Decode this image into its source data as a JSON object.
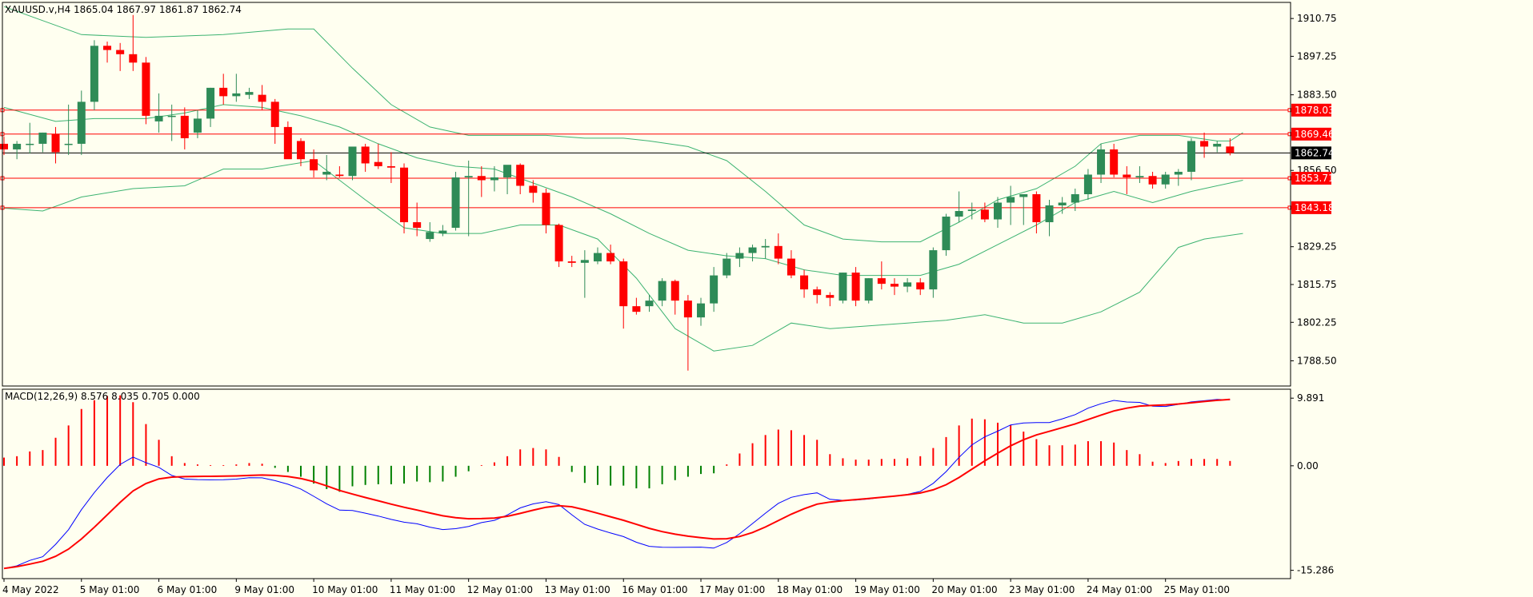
{
  "header": {
    "symbol": "XAUUSD.v,H4",
    "ohlc": "1865.04 1867.97 1861.87 1862.74"
  },
  "macd_header": "MACD(12,26,9) 8.576 8.035 0.705 0.000",
  "colors": {
    "background": "#fffff0",
    "bull": "#2e8b57",
    "bear": "#ff0000",
    "bands": "#3cb371",
    "level_line": "#ff0000",
    "macd_line": "#0000ff",
    "signal_line": "#ff0000",
    "hist_pos": "#ff0000",
    "hist_neg": "#008000"
  },
  "chart_data": [
    {
      "type": "candlestick",
      "title": "XAUUSD.v,H4",
      "price_range": [
        1779.5,
        1916.5
      ],
      "y_ticks": [
        "1910.75",
        "1897.25",
        "1883.50",
        "1856.50",
        "1829.25",
        "1815.75",
        "1802.25",
        "1788.50"
      ],
      "x_ticks": [
        "4 May 2022",
        "5 May 01:00",
        "6 May 01:00",
        "9 May 01:00",
        "10 May 01:00",
        "11 May 01:00",
        "12 May 01:00",
        "13 May 01:00",
        "16 May 01:00",
        "17 May 01:00",
        "18 May 01:00",
        "19 May 01:00",
        "20 May 01:00",
        "23 May 01:00",
        "24 May 01:00",
        "25 May 01:00"
      ],
      "current_price": "1862.74",
      "levels": [
        "1878.03",
        "1869.46",
        "1853.71",
        "1843.18"
      ],
      "candles": [
        [
          1866.0,
          1868.5,
          1862.0,
          1864.0
        ],
        [
          1864.0,
          1867.0,
          1860.5,
          1866.0
        ],
        [
          1866.0,
          1873.5,
          1862.5,
          1866.0
        ],
        [
          1866.0,
          1870.0,
          1863.0,
          1870.0
        ],
        [
          1869.5,
          1872.0,
          1859.0,
          1863.0
        ],
        [
          1866.0,
          1880.0,
          1862.0,
          1866.0
        ],
        [
          1866.0,
          1885.0,
          1862.0,
          1881.0
        ],
        [
          1881.0,
          1903.0,
          1878.0,
          1901.0
        ],
        [
          1901.0,
          1902.5,
          1895.0,
          1899.5
        ],
        [
          1899.5,
          1902.0,
          1892.0,
          1898.0
        ],
        [
          1898.0,
          1912.0,
          1892.0,
          1895.0
        ],
        [
          1895.0,
          1897.0,
          1873.0,
          1876.0
        ],
        [
          1874.0,
          1884.0,
          1870.0,
          1876.0
        ],
        [
          1876.0,
          1880.0,
          1867.0,
          1876.0
        ],
        [
          1876.0,
          1879.0,
          1864.0,
          1868.0
        ],
        [
          1870.0,
          1878.0,
          1868.0,
          1875.0
        ],
        [
          1875.0,
          1886.0,
          1872.0,
          1886.0
        ],
        [
          1886.0,
          1891.0,
          1880.0,
          1883.0
        ],
        [
          1883.0,
          1891.0,
          1881.0,
          1884.0
        ],
        [
          1883.5,
          1886.0,
          1882.0,
          1884.5
        ],
        [
          1883.5,
          1887.0,
          1878.0,
          1881.0
        ],
        [
          1881.0,
          1882.0,
          1866.0,
          1872.0
        ],
        [
          1872.0,
          1874.0,
          1863.0,
          1860.5
        ],
        [
          1867.0,
          1868.0,
          1858.0,
          1860.5
        ],
        [
          1860.5,
          1864.0,
          1854.0,
          1856.5
        ],
        [
          1855.0,
          1862.0,
          1853.0,
          1856.0
        ],
        [
          1855.0,
          1858.0,
          1854.0,
          1854.5
        ],
        [
          1854.5,
          1864.0,
          1853.0,
          1865.0
        ],
        [
          1865.0,
          1866.0,
          1856.0,
          1859.0
        ],
        [
          1859.5,
          1866.0,
          1857.0,
          1858.0
        ],
        [
          1858.0,
          1863.0,
          1852.0,
          1857.5
        ],
        [
          1857.5,
          1859.0,
          1834.0,
          1838.0
        ],
        [
          1838.0,
          1845.0,
          1833.0,
          1836.0
        ],
        [
          1832.0,
          1838.0,
          1831.0,
          1834.5
        ],
        [
          1834.0,
          1837.0,
          1833.0,
          1835.0
        ],
        [
          1836.0,
          1856.0,
          1835.0,
          1854.0
        ],
        [
          1854.0,
          1860.0,
          1833.0,
          1854.5
        ],
        [
          1854.5,
          1858.0,
          1847.0,
          1853.0
        ],
        [
          1853.0,
          1858.0,
          1849.0,
          1854.0
        ],
        [
          1854.0,
          1858.0,
          1848.0,
          1858.5
        ],
        [
          1858.5,
          1859.0,
          1848.0,
          1851.0
        ],
        [
          1851.0,
          1853.0,
          1845.0,
          1848.5
        ],
        [
          1848.5,
          1850.0,
          1834.0,
          1837.0
        ],
        [
          1837.0,
          1837.5,
          1822.0,
          1824.0
        ],
        [
          1824.0,
          1826.0,
          1822.0,
          1823.5
        ],
        [
          1823.5,
          1828.0,
          1811.0,
          1824.5
        ],
        [
          1824.0,
          1829.0,
          1823.0,
          1827.0
        ],
        [
          1827.0,
          1830.0,
          1823.0,
          1824.0
        ],
        [
          1824.0,
          1825.0,
          1800.0,
          1808.0
        ],
        [
          1808.0,
          1811.0,
          1805.0,
          1806.0
        ],
        [
          1808.0,
          1812.0,
          1806.0,
          1810.0
        ],
        [
          1810.0,
          1818.0,
          1808.0,
          1817.0
        ],
        [
          1817.0,
          1817.5,
          1805.0,
          1810.0
        ],
        [
          1810.0,
          1812.0,
          1785.0,
          1804.0
        ],
        [
          1804.0,
          1811.0,
          1801.0,
          1809.0
        ],
        [
          1809.0,
          1822.0,
          1806.0,
          1819.0
        ],
        [
          1819.0,
          1827.0,
          1818.0,
          1825.0
        ],
        [
          1825.0,
          1829.0,
          1822.0,
          1827.0
        ],
        [
          1827.0,
          1830.0,
          1824.0,
          1829.0
        ],
        [
          1829.0,
          1832.0,
          1825.0,
          1829.5
        ],
        [
          1829.5,
          1834.0,
          1823.0,
          1825.0
        ],
        [
          1825.0,
          1828.0,
          1818.0,
          1819.0
        ],
        [
          1819.0,
          1821.0,
          1811.0,
          1814.0
        ],
        [
          1814.0,
          1815.0,
          1809.0,
          1812.0
        ],
        [
          1812.0,
          1813.0,
          1808.0,
          1811.0
        ],
        [
          1810.0,
          1820.0,
          1809.0,
          1820.0
        ],
        [
          1820.0,
          1822.0,
          1808.0,
          1810.0
        ],
        [
          1810.0,
          1818.0,
          1809.0,
          1818.0
        ],
        [
          1818.0,
          1824.0,
          1814.0,
          1816.0
        ],
        [
          1816.0,
          1818.0,
          1812.0,
          1815.0
        ],
        [
          1815.0,
          1818.0,
          1813.0,
          1816.5
        ],
        [
          1816.5,
          1818.0,
          1812.0,
          1814.0
        ],
        [
          1814.0,
          1829.0,
          1811.0,
          1828.0
        ],
        [
          1828.0,
          1841.0,
          1826.0,
          1840.0
        ],
        [
          1840.0,
          1849.0,
          1838.0,
          1842.0
        ],
        [
          1842.0,
          1845.0,
          1839.0,
          1842.5
        ],
        [
          1842.5,
          1845.0,
          1838.0,
          1839.0
        ],
        [
          1839.0,
          1847.0,
          1836.0,
          1845.0
        ],
        [
          1845.0,
          1851.0,
          1837.0,
          1847.0
        ],
        [
          1847.0,
          1848.0,
          1837.0,
          1848.0
        ],
        [
          1848.0,
          1849.0,
          1834.0,
          1838.0
        ],
        [
          1838.0,
          1846.0,
          1833.0,
          1844.0
        ],
        [
          1844.0,
          1847.0,
          1841.0,
          1845.0
        ],
        [
          1845.0,
          1850.0,
          1842.0,
          1848.0
        ],
        [
          1848.0,
          1857.0,
          1846.0,
          1855.0
        ],
        [
          1855.0,
          1866.0,
          1852.0,
          1864.0
        ],
        [
          1864.0,
          1866.0,
          1854.0,
          1855.0
        ],
        [
          1855.0,
          1858.0,
          1848.0,
          1854.0
        ],
        [
          1854.0,
          1858.0,
          1852.0,
          1854.5
        ],
        [
          1854.5,
          1856.0,
          1850.0,
          1851.5
        ],
        [
          1851.5,
          1856.0,
          1850.0,
          1855.0
        ],
        [
          1855.0,
          1857.0,
          1851.0,
          1856.0
        ],
        [
          1856.0,
          1868.0,
          1853.0,
          1867.0
        ],
        [
          1867.0,
          1870.0,
          1861.0,
          1865.0
        ],
        [
          1865.0,
          1867.0,
          1863.0,
          1866.0
        ],
        [
          1865.04,
          1867.97,
          1861.87,
          1862.74
        ]
      ],
      "bollinger": {
        "upper": [
          [
            0,
            1915
          ],
          [
            6,
            1905
          ],
          [
            11,
            1904
          ],
          [
            17,
            1905
          ],
          [
            22,
            1907
          ],
          [
            24,
            1907
          ],
          [
            27,
            1893
          ],
          [
            30,
            1880
          ],
          [
            33,
            1872
          ],
          [
            36,
            1869
          ],
          [
            39,
            1869
          ],
          [
            42,
            1869
          ],
          [
            45,
            1868
          ],
          [
            48,
            1868
          ],
          [
            50,
            1867
          ],
          [
            53,
            1865
          ],
          [
            56,
            1860
          ],
          [
            59,
            1849
          ],
          [
            62,
            1837
          ],
          [
            65,
            1832
          ],
          [
            68,
            1831
          ],
          [
            71,
            1831
          ],
          [
            74,
            1838
          ],
          [
            77,
            1846
          ],
          [
            80,
            1850
          ],
          [
            83,
            1858
          ],
          [
            85,
            1866
          ],
          [
            88,
            1869
          ],
          [
            91,
            1869
          ],
          [
            94,
            1867
          ],
          [
            95,
            1867
          ],
          [
            96,
            1870
          ]
        ],
        "middle": [
          [
            0,
            1879
          ],
          [
            4,
            1874
          ],
          [
            7,
            1875
          ],
          [
            11,
            1875
          ],
          [
            14,
            1877
          ],
          [
            17,
            1880
          ],
          [
            20,
            1879
          ],
          [
            23,
            1876
          ],
          [
            26,
            1872
          ],
          [
            29,
            1866
          ],
          [
            32,
            1861
          ],
          [
            35,
            1858
          ],
          [
            38,
            1857
          ],
          [
            41,
            1852
          ],
          [
            44,
            1847
          ],
          [
            47,
            1841
          ],
          [
            50,
            1834
          ],
          [
            53,
            1828
          ],
          [
            56,
            1826
          ],
          [
            59,
            1825
          ],
          [
            62,
            1821
          ],
          [
            65,
            1819
          ],
          [
            68,
            1819
          ],
          [
            71,
            1819
          ],
          [
            74,
            1823
          ],
          [
            77,
            1830
          ],
          [
            80,
            1837
          ],
          [
            83,
            1845
          ],
          [
            86,
            1849
          ],
          [
            89,
            1845
          ],
          [
            92,
            1849
          ],
          [
            95,
            1852
          ],
          [
            96,
            1853
          ]
        ],
        "lower": [
          [
            0,
            1843
          ],
          [
            3,
            1842
          ],
          [
            6,
            1847
          ],
          [
            10,
            1850
          ],
          [
            14,
            1851
          ],
          [
            17,
            1857
          ],
          [
            20,
            1857
          ],
          [
            24,
            1860
          ],
          [
            26,
            1853
          ],
          [
            28,
            1846
          ],
          [
            31,
            1836
          ],
          [
            34,
            1834
          ],
          [
            37,
            1834
          ],
          [
            40,
            1837
          ],
          [
            43,
            1837
          ],
          [
            46,
            1832
          ],
          [
            49,
            1818
          ],
          [
            52,
            1800
          ],
          [
            55,
            1792
          ],
          [
            58,
            1794
          ],
          [
            61,
            1802
          ],
          [
            64,
            1800
          ],
          [
            67,
            1801
          ],
          [
            70,
            1802
          ],
          [
            73,
            1803
          ],
          [
            76,
            1805
          ],
          [
            79,
            1802
          ],
          [
            82,
            1802
          ],
          [
            85,
            1806
          ],
          [
            88,
            1813
          ],
          [
            91,
            1829
          ],
          [
            93,
            1832
          ],
          [
            96,
            1834
          ]
        ]
      }
    },
    {
      "type": "line+bar",
      "title": "MACD(12,26,9)",
      "y_range": [
        -16.5,
        11.2
      ],
      "y_ticks": [
        "9.891",
        "0.00",
        "-15.286"
      ],
      "histogram": [
        1.2,
        1.4,
        2.1,
        2.3,
        4.1,
        5.9,
        8.3,
        9.6,
        10.2,
        10.3,
        9.3,
        6.1,
        3.8,
        1.4,
        0.4,
        0.2,
        0.1,
        0.1,
        0.2,
        0.4,
        0.3,
        -0.3,
        -0.9,
        -1.6,
        -2.6,
        -3.4,
        -3.8,
        -3.0,
        -2.8,
        -2.7,
        -2.7,
        -2.6,
        -2.3,
        -2.4,
        -2.3,
        -1.6,
        -0.8,
        0.1,
        0.5,
        1.4,
        2.4,
        2.6,
        2.4,
        1.3,
        -0.9,
        -2.5,
        -2.8,
        -2.9,
        -2.9,
        -3.3,
        -3.3,
        -2.7,
        -2.1,
        -1.6,
        -1.2,
        -1.1,
        0.2,
        1.8,
        3.3,
        4.5,
        5.3,
        5.2,
        4.5,
        3.8,
        1.7,
        1.1,
        0.9,
        0.9,
        1.0,
        1.0,
        1.1,
        1.4,
        2.6,
        4.2,
        5.9,
        6.9,
        6.8,
        6.3,
        6.0,
        5.0,
        3.9,
        3.0,
        3.0,
        3.1,
        3.6,
        3.6,
        3.4,
        2.3,
        1.7,
        0.6,
        0.4,
        0.7,
        1.0,
        1.0,
        1.0,
        0.705
      ]
    }
  ]
}
